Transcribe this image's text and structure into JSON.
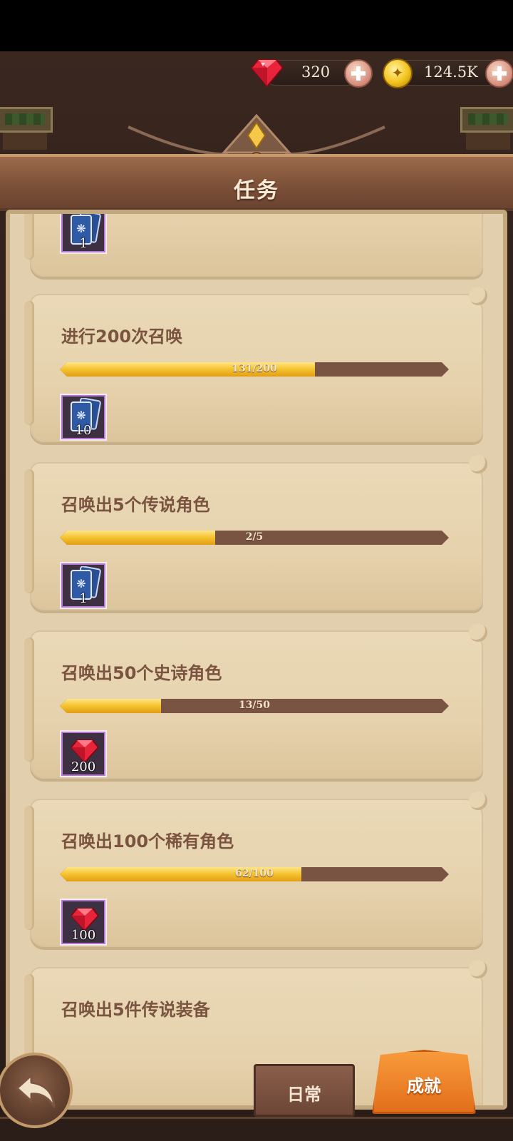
{
  "currency": {
    "gems": "320",
    "gold": "124.5K"
  },
  "header": {
    "title": "任务"
  },
  "tasks": [
    {
      "title": "",
      "progress_text": "",
      "progress": 0,
      "reward_type": "summon-card",
      "reward_count": "1"
    },
    {
      "title": "进行200次召唤",
      "progress_text": "131/200",
      "progress": 0.655,
      "reward_type": "summon-card",
      "reward_count": "10"
    },
    {
      "title": "召唤出5个传说角色",
      "progress_text": "2/5",
      "progress": 0.4,
      "reward_type": "summon-card",
      "reward_count": "1"
    },
    {
      "title": "召唤出50个史诗角色",
      "progress_text": "13/50",
      "progress": 0.26,
      "reward_type": "gem",
      "reward_count": "200"
    },
    {
      "title": "召唤出100个稀有角色",
      "progress_text": "62/100",
      "progress": 0.62,
      "reward_type": "gem",
      "reward_count": "100"
    },
    {
      "title": "召唤出5件传说装备",
      "progress_text": "",
      "progress": 0,
      "reward_type": "",
      "reward_count": ""
    }
  ],
  "tabs": {
    "daily": "日常",
    "achievement": "成就",
    "active": "achievement"
  },
  "colors": {
    "accent": "#e8791f",
    "progress_fill": "#f5c534",
    "card_bg": "#e6d2ad"
  },
  "icons": {
    "gem": "gem-icon",
    "coin": "gold-coin-icon",
    "back": "back-arrow-icon",
    "add": "plus-icon",
    "summon_card": "summon-card-icon"
  }
}
